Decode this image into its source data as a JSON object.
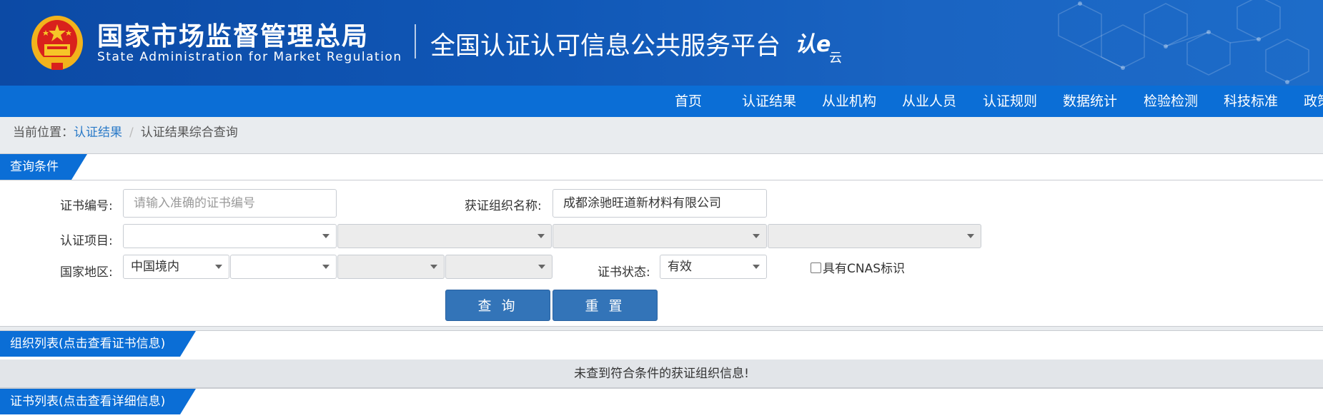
{
  "header": {
    "agency_cn": "国家市场监督管理总局",
    "agency_en": "State Administration  for  Market Regulation",
    "platform_title": "全国认证认可信息公共服务平台",
    "logo_text_main": "认e",
    "logo_text_sub": "云",
    "emblem_icon": "national-emblem-icon",
    "colors": {
      "header_bg": "#1057b6",
      "nav_bg": "#0b6ed6",
      "panel_tab": "#0b6ed6",
      "button": "#3374b8"
    }
  },
  "nav": {
    "items": [
      "首页",
      "认证结果",
      "从业机构",
      "从业人员",
      "认证规则",
      "数据统计",
      "检验检测",
      "科技标准",
      "政策"
    ]
  },
  "breadcrumb": {
    "prefix": "当前位置：",
    "link": "认证结果",
    "separator": "/",
    "current": "认证结果综合查询"
  },
  "query_panel": {
    "title": "查询条件",
    "cert_no_label": "证书编号:",
    "cert_no_placeholder": "请输入准确的证书编号",
    "cert_no_value": "",
    "org_name_label": "获证组织名称:",
    "org_name_value": "成都涂驰旺道新材料有限公司",
    "project_label": "认证项目:",
    "project_selects": [
      "",
      "",
      "",
      ""
    ],
    "region_label": "国家地区:",
    "region_selects": [
      "中国境内",
      "",
      "",
      ""
    ],
    "status_label": "证书状态:",
    "status_value": "有效",
    "cnas_label": "具有CNAS标识",
    "search_button": "查 询",
    "reset_button": "重 置"
  },
  "org_list": {
    "title": "组织列表(点击查看证书信息)",
    "empty_message": "未查到符合条件的获证组织信息!"
  },
  "cert_list": {
    "title": "证书列表(点击查看详细信息)"
  }
}
